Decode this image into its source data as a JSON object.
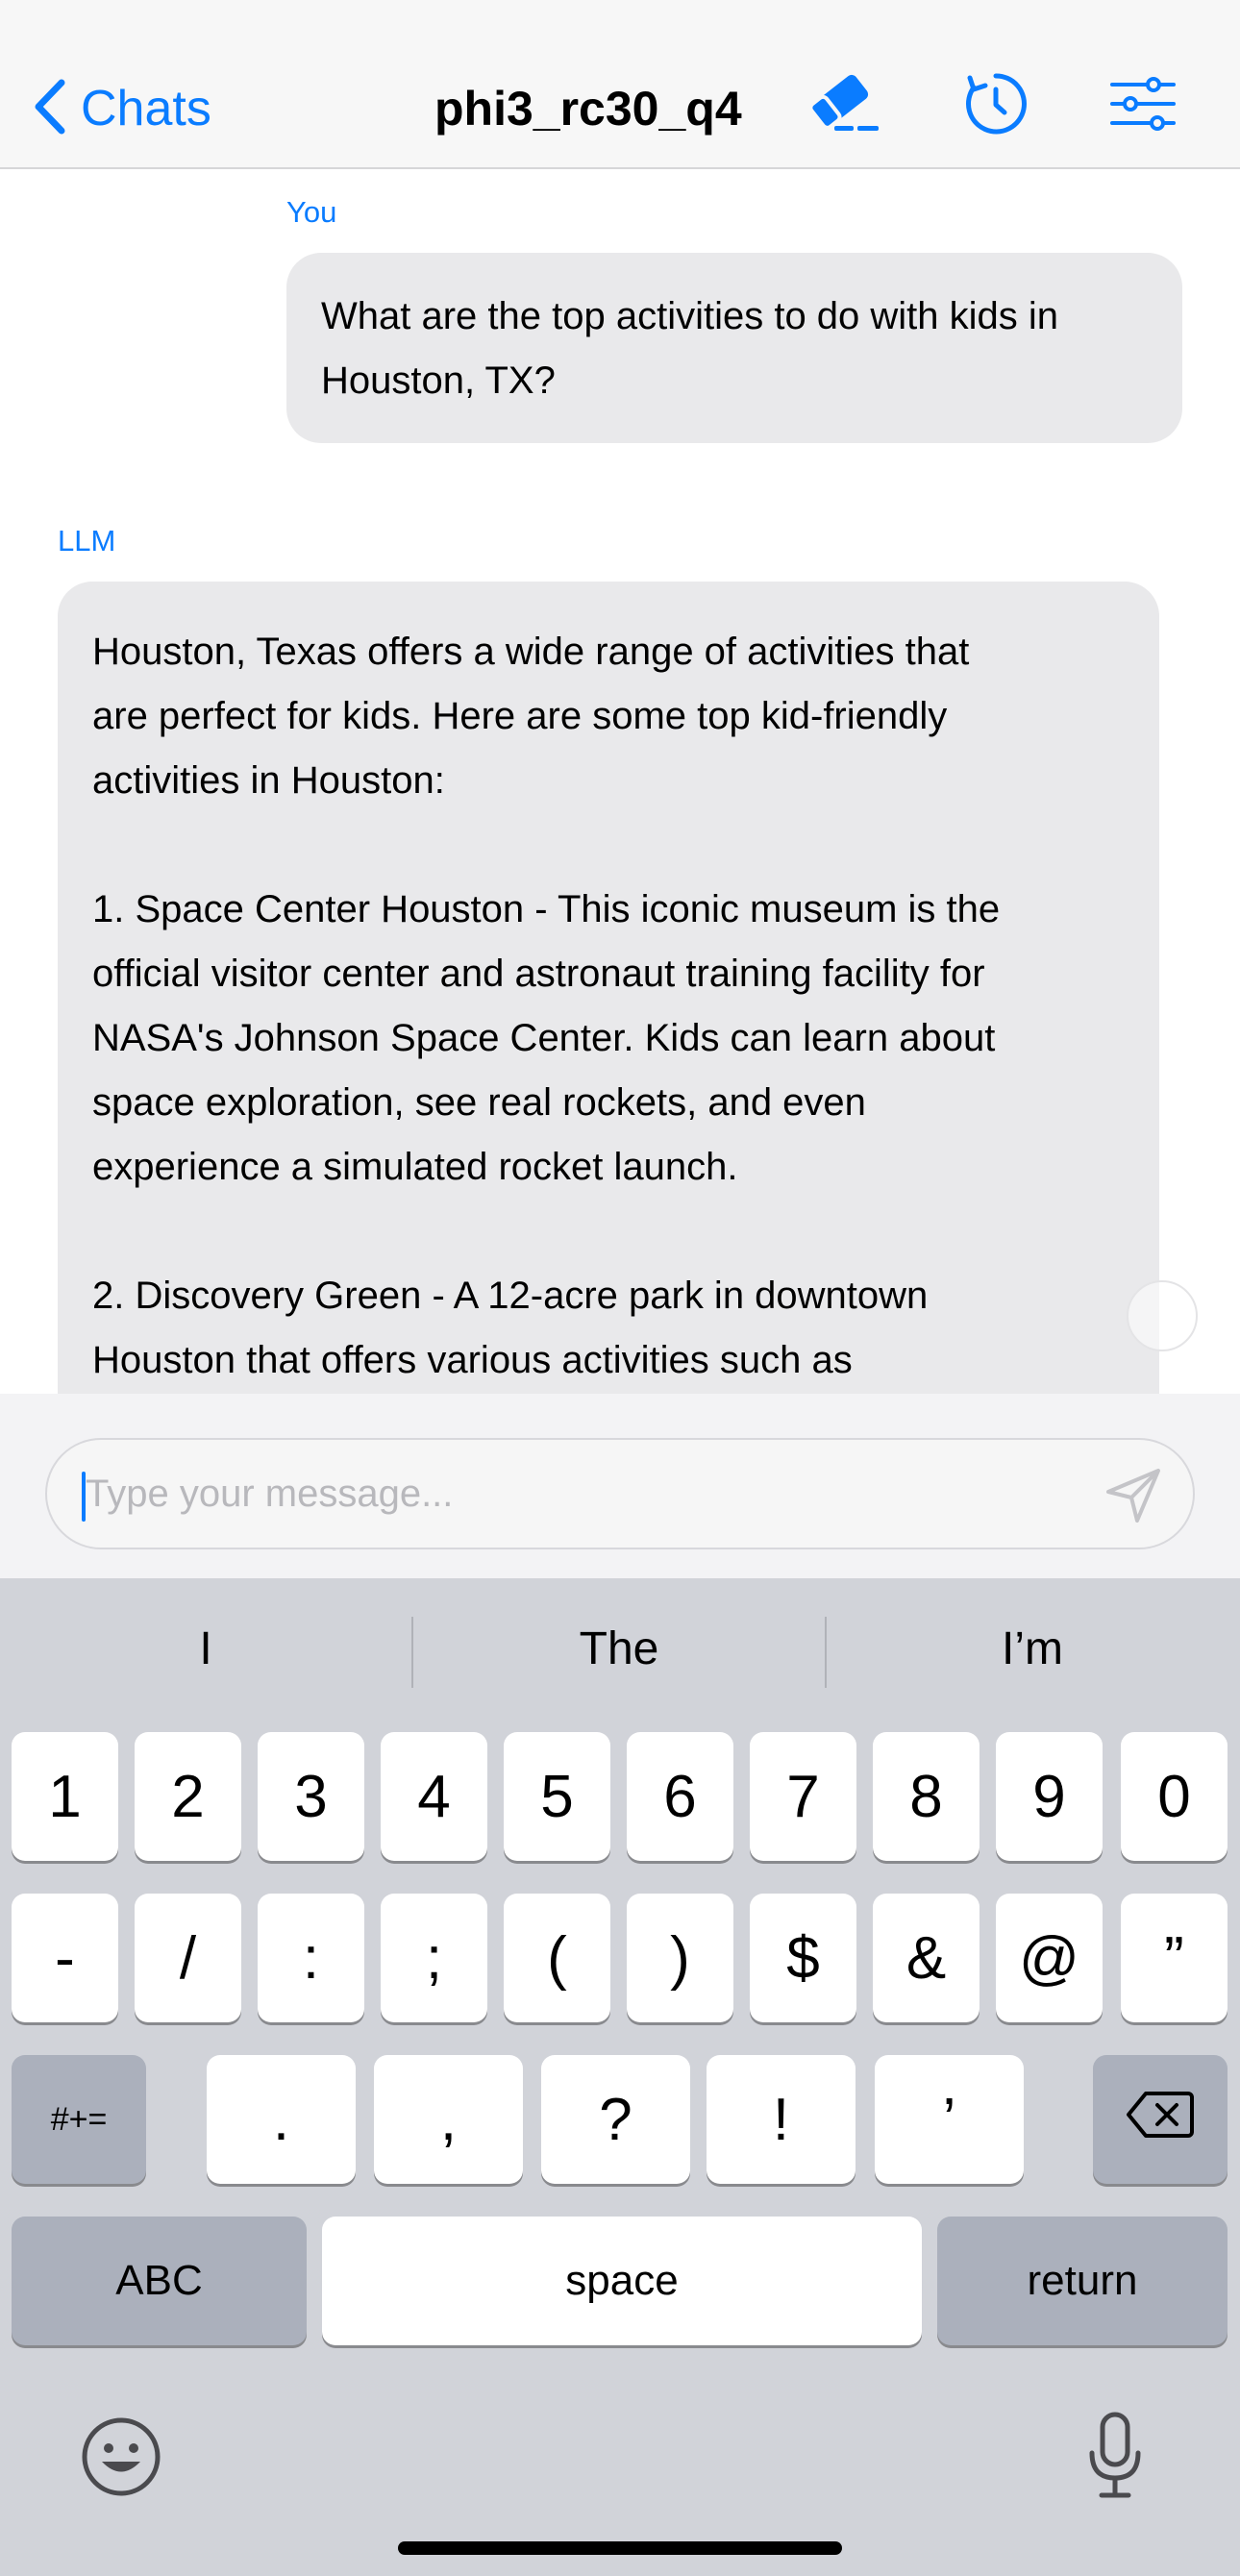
{
  "nav": {
    "back_label": "Chats",
    "title": "phi3_rc30_q4",
    "icons": [
      "chevron-left-icon",
      "eraser-icon",
      "refresh-icon",
      "sliders-icon"
    ],
    "accent": "#0a7cff"
  },
  "messages": [
    {
      "sender": "You",
      "text": "What are the top activities to do with kids in\nHouston, TX?"
    },
    {
      "sender": "LLM",
      "text": "Houston, Texas offers a wide range of activities that\nare perfect for kids. Here are some top kid-friendly\nactivities in Houston:\n\n1. Space Center Houston - This iconic museum is the\nofficial visitor center and astronaut training facility for\nNASA's Johnson Space Center. Kids can learn about\nspace exploration, see real rockets, and even\nexperience a simulated rocket launch.\n\n2. Discovery Green - A 12-acre park in downtown\nHouston that offers various activities such as"
    }
  ],
  "composer": {
    "placeholder": "Type your message..."
  },
  "keyboard": {
    "suggestions": [
      "I",
      "The",
      "I’m"
    ],
    "row1": [
      "1",
      "2",
      "3",
      "4",
      "5",
      "6",
      "7",
      "8",
      "9",
      "0"
    ],
    "row2": [
      "-",
      "/",
      ":",
      ";",
      "(",
      ")",
      "$",
      "&",
      "@",
      "”"
    ],
    "row3": {
      "mode": "#+=",
      "keys": [
        ".",
        ",",
        "?",
        "!",
        "’"
      ]
    },
    "row4": {
      "abc": "ABC",
      "space": "space",
      "return": "return"
    },
    "icons": [
      "delete-icon",
      "emoji-icon",
      "microphone-icon"
    ]
  }
}
